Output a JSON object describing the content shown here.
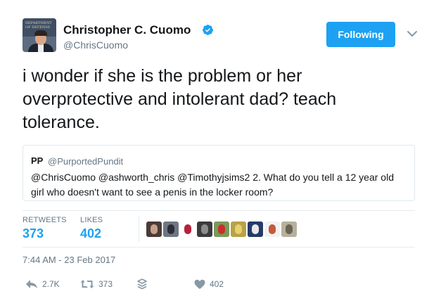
{
  "author": {
    "display_name": "Christopher C. Cuomo",
    "handle": "@ChrisCuomo",
    "avatar_sign_text": "DEPARTMENT OF DEFENSE"
  },
  "follow_button": {
    "label": "Following"
  },
  "tweet": {
    "text": "i wonder if she is the problem or her overprotective and intolerant dad? teach tolerance."
  },
  "quoted_tweet": {
    "name": "PP",
    "handle": "@PurportedPundit",
    "text": "@ChrisCuomo @ashworth_chris @Timothyjsims2 2. What do you tell a 12 year old girl who doesn't want to see a penis in the locker room?"
  },
  "stats": {
    "retweets_label": "RETWEETS",
    "retweets_value": "373",
    "likes_label": "LIKES",
    "likes_value": "402"
  },
  "likers": [
    {
      "icon": "liker-avatar-1",
      "bg": "#4a3b38",
      "fg": "#c8a088"
    },
    {
      "icon": "liker-avatar-2",
      "bg": "#6f7682",
      "fg": "#2a2f3a"
    },
    {
      "icon": "liker-avatar-3",
      "bg": "#ffffff",
      "fg": "#b5223b"
    },
    {
      "icon": "liker-avatar-4",
      "bg": "#3b3a3d",
      "fg": "#8c8c8c"
    },
    {
      "icon": "liker-avatar-5",
      "bg": "#7a9a5a",
      "fg": "#c9302c"
    },
    {
      "icon": "liker-avatar-6",
      "bg": "#b8a24a",
      "fg": "#e8d070"
    },
    {
      "icon": "liker-avatar-7",
      "bg": "#243a6a",
      "fg": "#e8e8e8"
    },
    {
      "icon": "liker-avatar-8",
      "bg": "#f2f2f2",
      "fg": "#c45a3c"
    },
    {
      "icon": "liker-avatar-9",
      "bg": "#b7b09c",
      "fg": "#6a6352"
    }
  ],
  "timestamp": "7:44 AM - 23 Feb 2017",
  "actions": {
    "reply_count": "2.7K",
    "retweet_count": "373",
    "like_count": "402"
  },
  "colors": {
    "accent": "#1da1f2",
    "secondary_text": "#657786",
    "primary_text": "#14171a"
  }
}
